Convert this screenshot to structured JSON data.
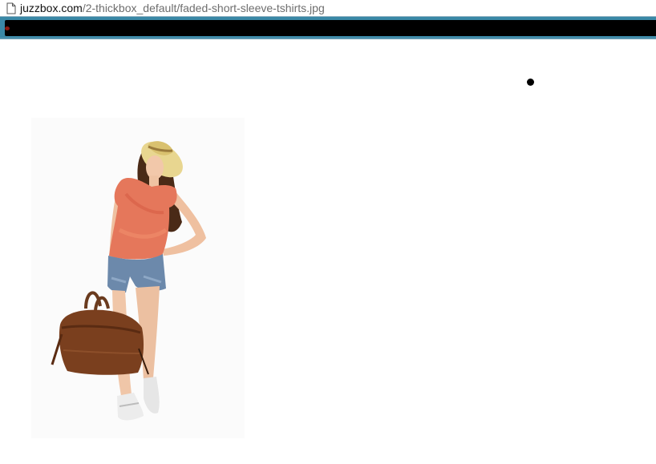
{
  "address_bar": {
    "domain": "juzzbox.com",
    "path": "/2-thickbox_default/faded-short-sleeve-tshirts.jpg"
  },
  "icons": {
    "page": "page-icon"
  },
  "colors": {
    "address_blue": "#3a88a6",
    "redaction": "#000000",
    "url_text": "#6d6d6d"
  },
  "image": {
    "subject": "product-photo"
  }
}
